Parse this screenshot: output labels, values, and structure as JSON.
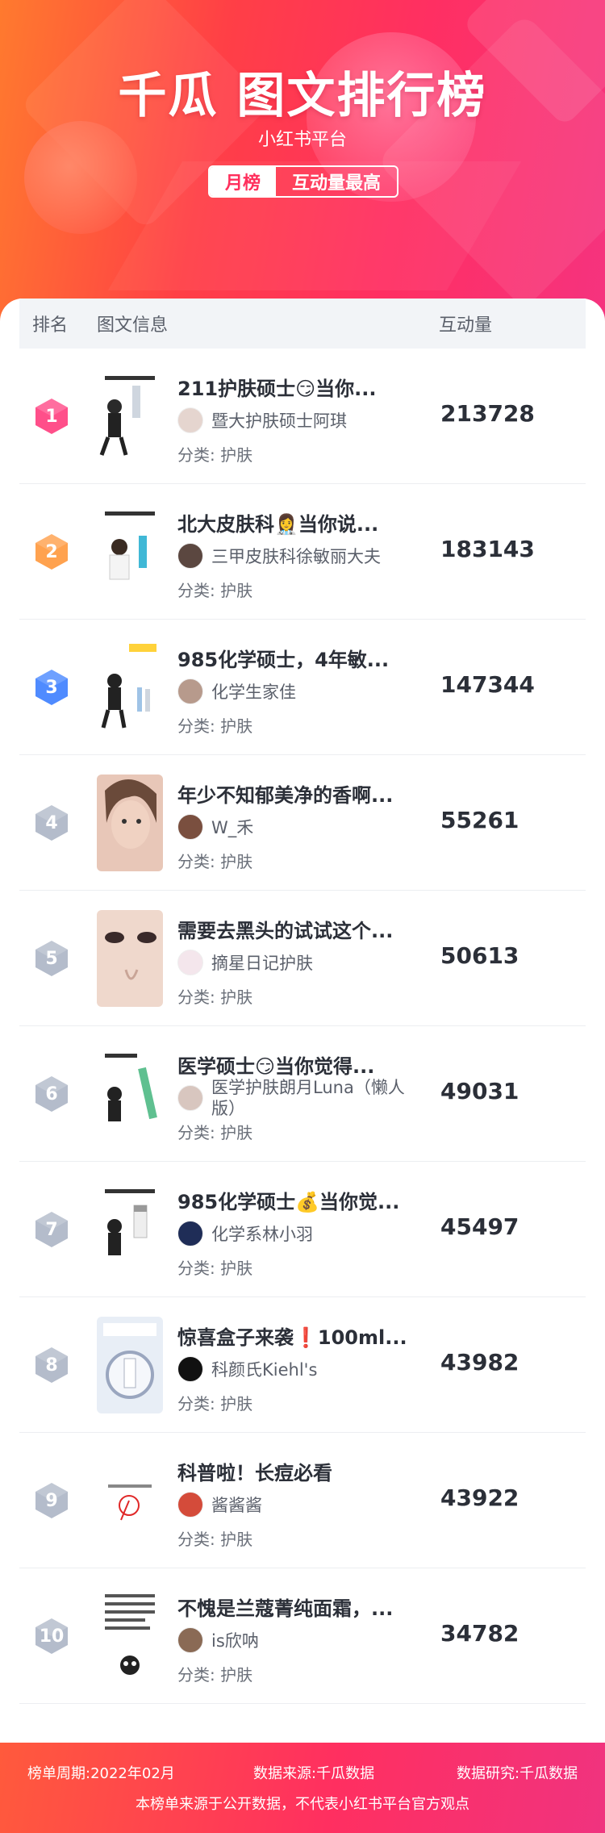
{
  "header": {
    "title": "千瓜 图文排行榜",
    "subtitle": "小红书平台",
    "badge_period": "月榜",
    "badge_type": "互动量最高"
  },
  "table": {
    "col_rank": "排名",
    "col_info": "图文信息",
    "col_interaction": "互动量"
  },
  "rows": [
    {
      "rank": "1",
      "title": "211护肤硕士😏当你...",
      "author": "暨大护肤硕士阿琪",
      "category": "分类: 护肤",
      "score": "213728",
      "badge_color": "#ff4f8a"
    },
    {
      "rank": "2",
      "title": "北大皮肤科👩‍⚕️当你说...",
      "author": "三甲皮肤科徐敏丽大夫",
      "category": "分类: 护肤",
      "score": "183143",
      "badge_color": "#ffa24f"
    },
    {
      "rank": "3",
      "title": "985化学硕士，4年敏...",
      "author": "化学生家佳",
      "category": "分类: 护肤",
      "score": "147344",
      "badge_color": "#4f8bff"
    },
    {
      "rank": "4",
      "title": "年少不知郁美净的香啊...",
      "author": "W_禾",
      "category": "分类: 护肤",
      "score": "55261",
      "badge_color": "#b4bccb"
    },
    {
      "rank": "5",
      "title": "需要去黑头的试试这个...",
      "author": "摘星日记护肤",
      "category": "分类: 护肤",
      "score": "50613",
      "badge_color": "#b4bccb"
    },
    {
      "rank": "6",
      "title": "医学硕士😏当你觉得...",
      "author": "医学护肤朗月Luna（懒人版）",
      "category": "分类: 护肤",
      "score": "49031",
      "badge_color": "#b4bccb"
    },
    {
      "rank": "7",
      "title": "985化学硕士💰当你觉...",
      "author": "化学系林小羽",
      "category": "分类: 护肤",
      "score": "45497",
      "badge_color": "#b4bccb"
    },
    {
      "rank": "8",
      "title": "惊喜盒子来袭❗100ml...",
      "author": "科颜氏Kiehl's",
      "category": "分类: 护肤",
      "score": "43982",
      "badge_color": "#b4bccb"
    },
    {
      "rank": "9",
      "title": "科普啦！长痘必看",
      "author": "酱酱酱",
      "category": "分类: 护肤",
      "score": "43922",
      "badge_color": "#b4bccb"
    },
    {
      "rank": "10",
      "title": "不愧是兰蔻菁纯面霜，...",
      "author": "is欣呐",
      "category": "分类: 护肤",
      "score": "34782",
      "badge_color": "#b4bccb"
    }
  ],
  "footer": {
    "period": "榜单周期:2022年02月",
    "source": "数据来源:千瓜数据",
    "research": "数据研究:千瓜数据",
    "disclaimer": "本榜单来源于公开数据，不代表小红书平台官方观点"
  }
}
